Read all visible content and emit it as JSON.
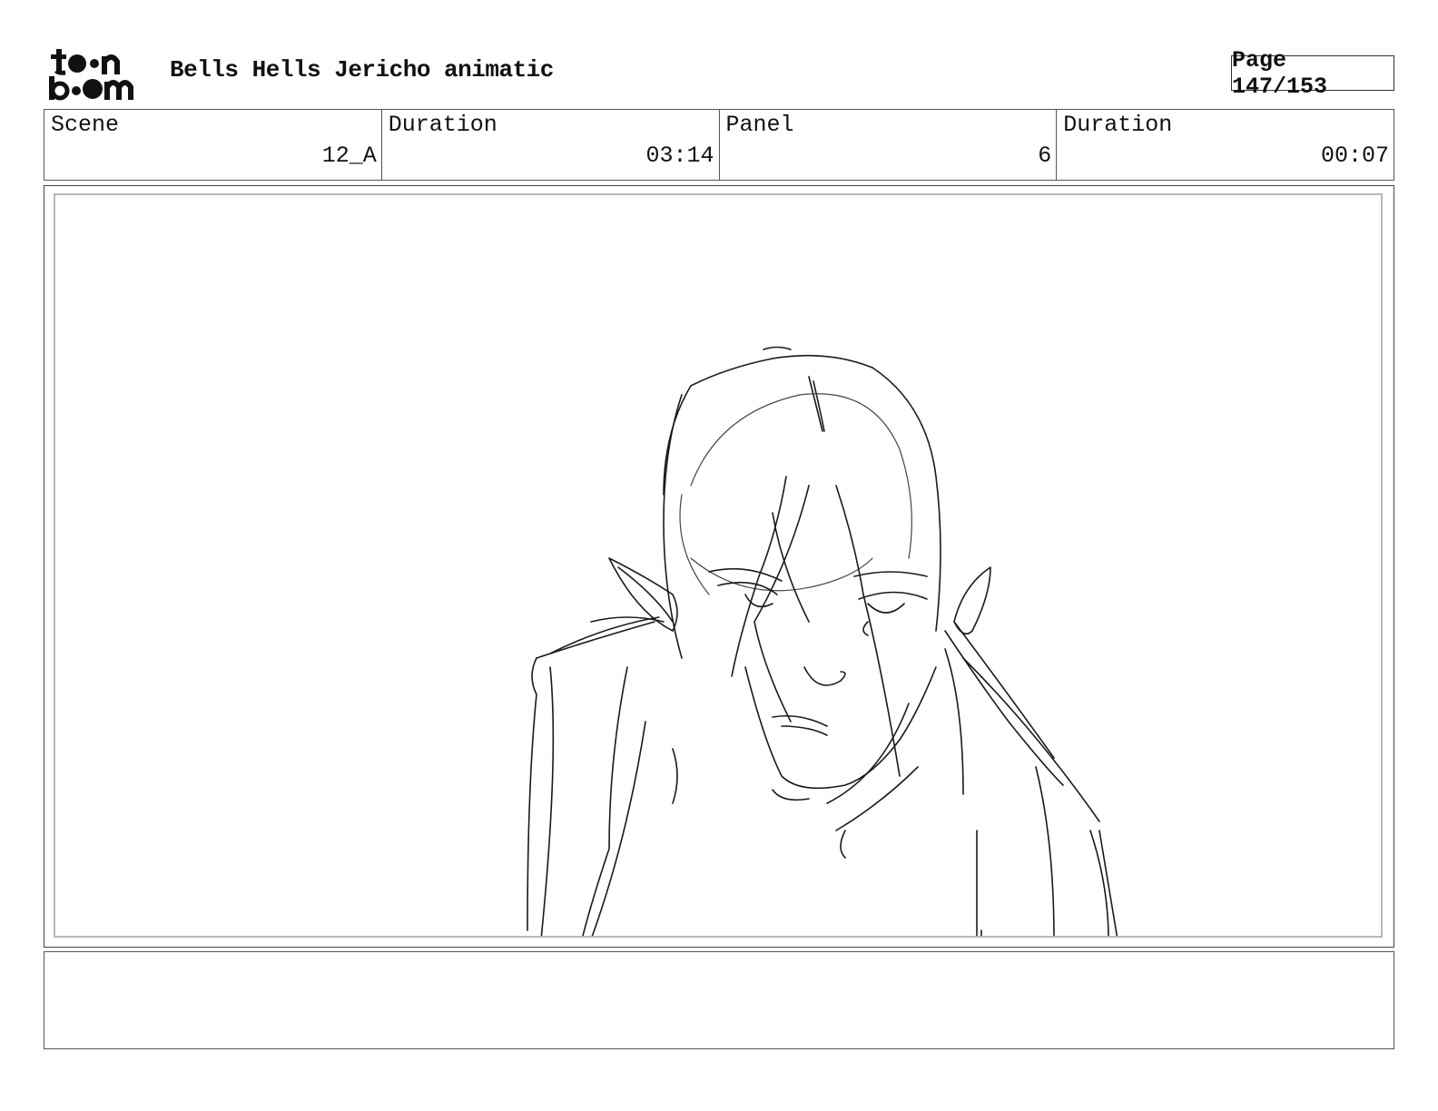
{
  "header": {
    "logo_text": "toon boom",
    "title": "Bells Hells Jericho animatic",
    "page": "Page 147/153"
  },
  "info": {
    "scene_label": "Scene",
    "scene_value": "12_A",
    "duration_label": "Duration",
    "duration_value": "03:14",
    "panel_label": "Panel",
    "panel_value": "6",
    "panel_duration_label": "Duration",
    "panel_duration_value": "00:07"
  },
  "notes": {
    "text": ""
  }
}
